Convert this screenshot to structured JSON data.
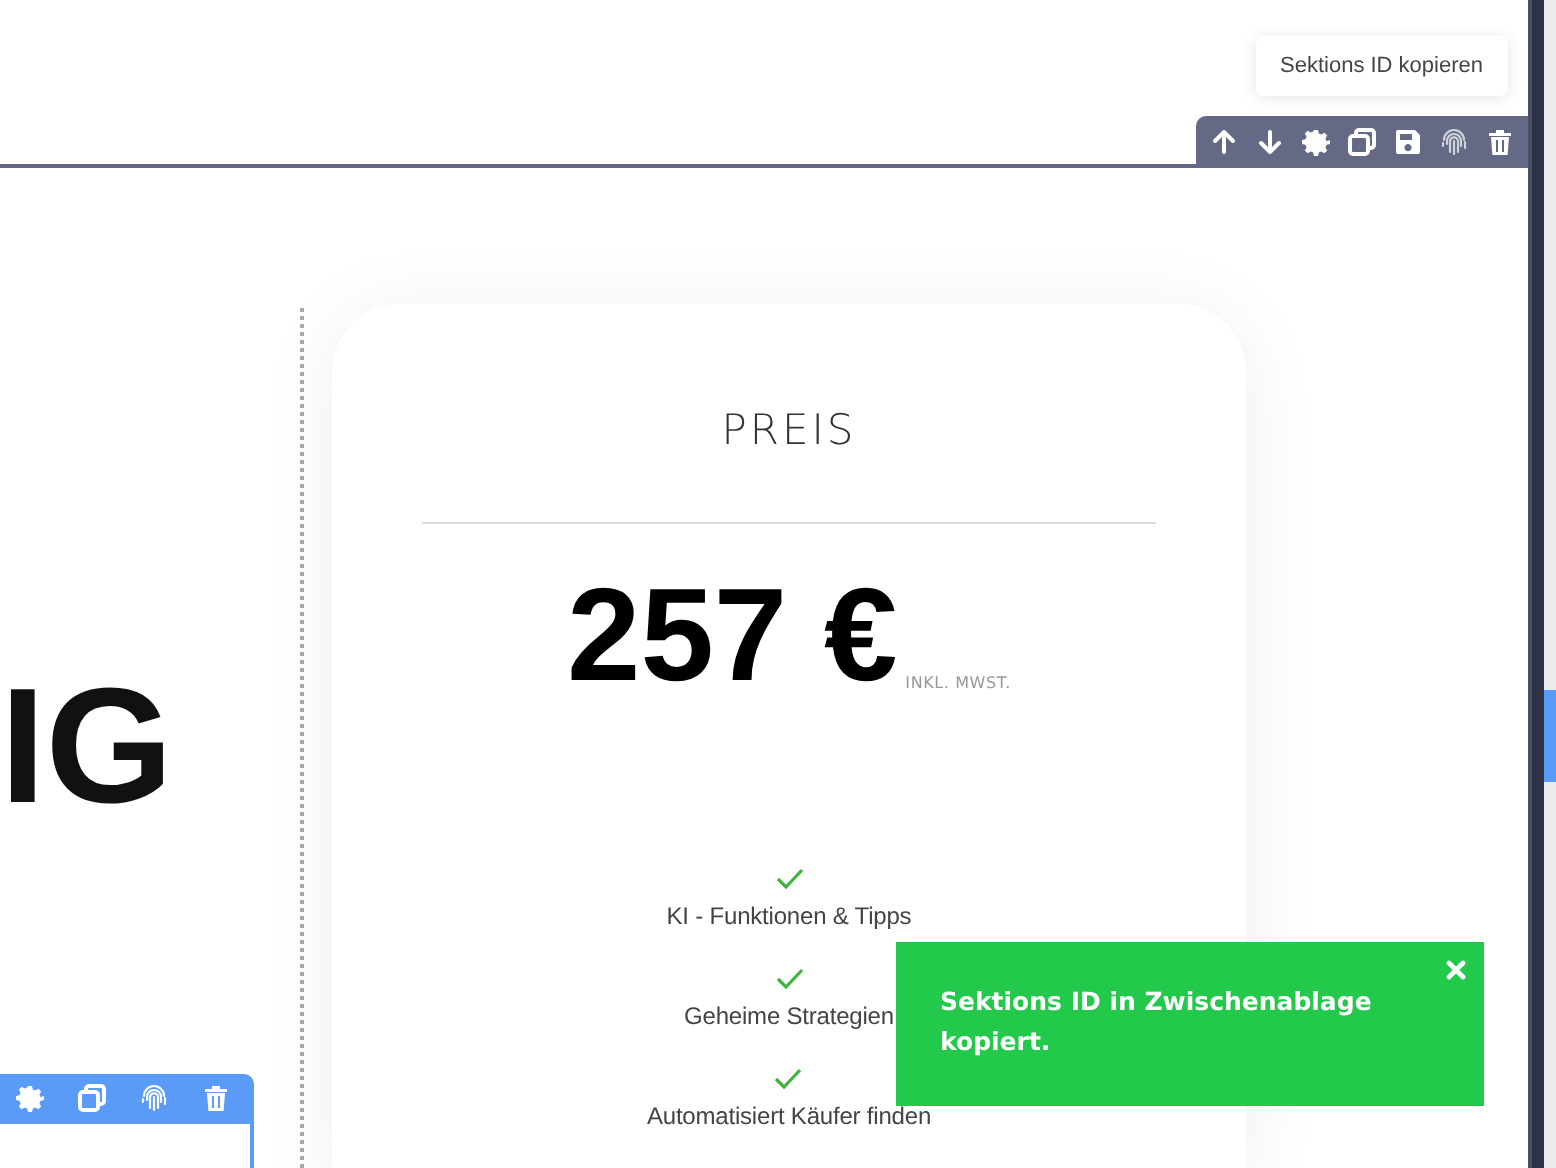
{
  "section_toolbar": {
    "tooltip": "Sektions ID kopieren",
    "buttons": [
      {
        "kind": "up"
      },
      {
        "kind": "down"
      },
      {
        "kind": "settings"
      },
      {
        "kind": "copy"
      },
      {
        "kind": "save"
      },
      {
        "kind": "fingerprint"
      },
      {
        "kind": "delete"
      }
    ]
  },
  "heading_fragment": "IG",
  "pricing_card": {
    "title": "PREIS",
    "price": "257 €",
    "price_note": "INKL. MWST.",
    "features": [
      "KI - Funktionen & Tipps",
      "Geheime Strategien",
      "Automatisiert Käufer finden"
    ]
  },
  "element_toolbar": {
    "buttons": [
      {
        "kind": "settings"
      },
      {
        "kind": "copy"
      },
      {
        "kind": "fingerprint"
      },
      {
        "kind": "delete"
      }
    ]
  },
  "toast": {
    "message": "Sektions ID in Zwischenablage kopiert."
  }
}
